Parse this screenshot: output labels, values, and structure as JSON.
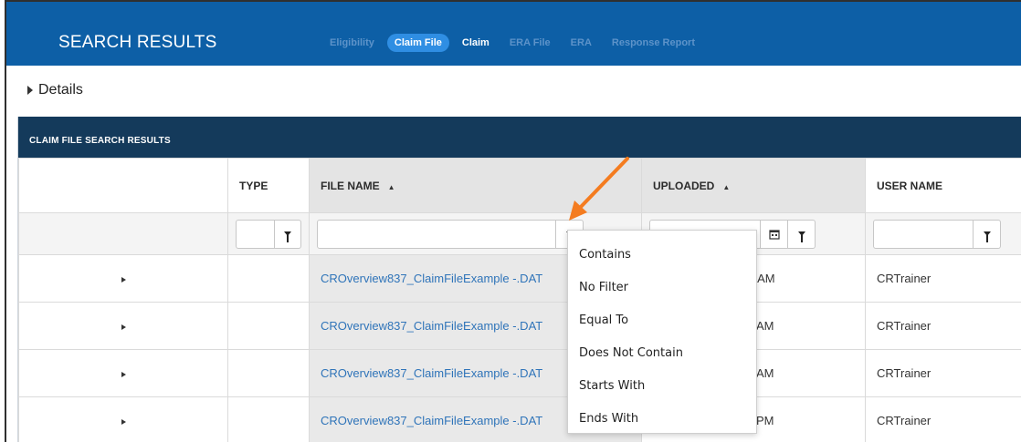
{
  "topbar": {
    "title": "SEARCH RESULTS",
    "tabs": [
      {
        "label": "Eligibility",
        "state": "dim"
      },
      {
        "label": "Claim File",
        "state": "active"
      },
      {
        "label": "Claim",
        "state": "on"
      },
      {
        "label": "ERA File",
        "state": "dim"
      },
      {
        "label": "ERA",
        "state": "dim"
      },
      {
        "label": "Response Report",
        "state": "dim"
      }
    ]
  },
  "details": {
    "label": "Details"
  },
  "panel": {
    "title": "CLAIM FILE SEARCH RESULTS"
  },
  "table": {
    "columns": [
      {
        "label": "",
        "sortable": false
      },
      {
        "label": "TYPE",
        "sortable": false
      },
      {
        "label": "FILE NAME",
        "sortable": true,
        "sort_glyph": "▲"
      },
      {
        "label": "UPLOADED",
        "sortable": true,
        "sort_glyph": "▲"
      },
      {
        "label": "USER NAME",
        "sortable": false
      }
    ],
    "rows": [
      {
        "file_name": "CROverview837_ClaimFileExample -.DAT",
        "uploaded": "8 AM",
        "user": "CRTrainer"
      },
      {
        "file_name": "CROverview837_ClaimFileExample -.DAT",
        "uploaded": "AM",
        "user": "CRTrainer"
      },
      {
        "file_name": "CROverview837_ClaimFileExample -.DAT",
        "uploaded": "AM",
        "user": "CRTrainer"
      },
      {
        "file_name": "CROverview837_ClaimFileExample -.DAT",
        "uploaded": "PM",
        "user": "CRTrainer"
      }
    ]
  },
  "filter_menu": {
    "items": [
      "Contains",
      "No Filter",
      "Equal To",
      "Does Not Contain",
      "Starts With",
      "Ends With"
    ]
  },
  "icons": {
    "filter": "funnel-icon",
    "calendar": "calendar-icon",
    "expand": "caret-right-icon",
    "annotation": "orange-arrow"
  },
  "colors": {
    "topbar": "#0d5fa6",
    "active_tab": "#2f8ee3",
    "panel_header": "#143a5b",
    "link": "#2f74b9",
    "annotation_arrow": "#f47c20"
  }
}
